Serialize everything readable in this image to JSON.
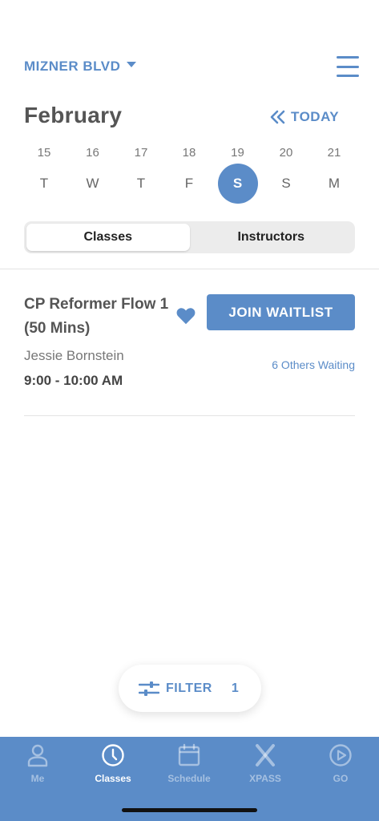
{
  "header": {
    "location": "MIZNER BLVD",
    "month": "February",
    "today_label": "TODAY"
  },
  "week": [
    {
      "num": "15",
      "day": "T",
      "selected": false
    },
    {
      "num": "16",
      "day": "W",
      "selected": false
    },
    {
      "num": "17",
      "day": "T",
      "selected": false
    },
    {
      "num": "18",
      "day": "F",
      "selected": false
    },
    {
      "num": "19",
      "day": "S",
      "selected": true
    },
    {
      "num": "20",
      "day": "S",
      "selected": false
    },
    {
      "num": "21",
      "day": "M",
      "selected": false
    }
  ],
  "segments": {
    "classes": "Classes",
    "instructors": "Instructors",
    "active": "Classes"
  },
  "class_item": {
    "name": "CP Reformer Flow 1 (50 Mins)",
    "instructor": "Jessie Bornstein",
    "time": "9:00 - 10:00 AM",
    "action": "JOIN WAITLIST",
    "waiting": "6 Others Waiting",
    "favorited": true
  },
  "filter": {
    "label": "FILTER",
    "count": "1",
    "icon": "sliders-icon"
  },
  "tabs": [
    {
      "label": "Me",
      "icon": "person-icon",
      "active": false
    },
    {
      "label": "Classes",
      "icon": "clock-icon",
      "active": true
    },
    {
      "label": "Schedule",
      "icon": "calendar-icon",
      "active": false
    },
    {
      "label": "XPASS",
      "icon": "x-icon",
      "active": false
    },
    {
      "label": "GO",
      "icon": "play-circle-icon",
      "active": false
    }
  ],
  "colors": {
    "accent": "#5b8cc8",
    "background": "#ffffff",
    "segment_bg": "#ececec"
  }
}
